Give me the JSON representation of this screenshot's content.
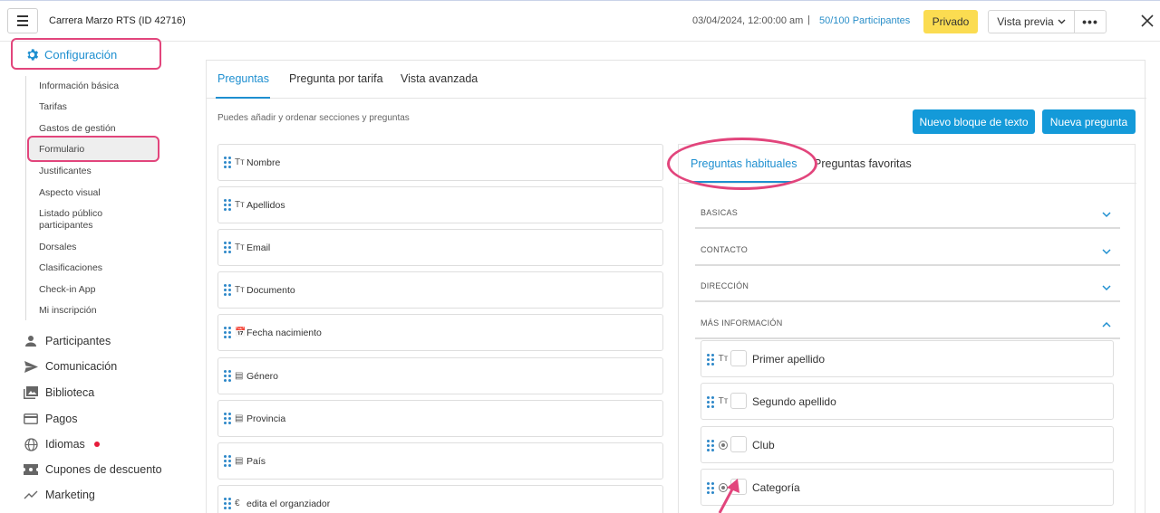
{
  "header": {
    "event_title": "Carrera Marzo RTS (ID 42716)",
    "date": "03/04/2024, 12:00:00 am",
    "separator": "|",
    "participants": "50/100 Participantes",
    "private_label": "Privado",
    "preview_label": "Vista previa",
    "more_label": "•••"
  },
  "sidebar": {
    "config_label": "Configuración",
    "sub_items": [
      "Información básica",
      "Tarifas",
      "Gastos de gestión",
      "Formulario",
      "Justificantes",
      "Aspecto visual",
      "Listado público participantes",
      "Dorsales",
      "Clasificaciones",
      "Check-in App",
      "Mi inscripción"
    ],
    "main_items": [
      {
        "label": "Participantes",
        "icon": "person-icon"
      },
      {
        "label": "Comunicación",
        "icon": "send-icon"
      },
      {
        "label": "Biblioteca",
        "icon": "library-icon"
      },
      {
        "label": "Pagos",
        "icon": "card-icon"
      },
      {
        "label": "Idiomas",
        "icon": "globe-icon"
      },
      {
        "label": "Cupones de descuento",
        "icon": "coupon-icon"
      },
      {
        "label": "Marketing",
        "icon": "trend-icon"
      }
    ]
  },
  "main": {
    "tabs": [
      "Preguntas",
      "Pregunta por tarifa",
      "Vista avanzada"
    ],
    "hint": "Puedes añadir y ordenar secciones y preguntas",
    "btn_text_block": "Nuevo bloque de texto",
    "btn_new_question": "Nueva pregunta",
    "questions": [
      {
        "icon": "Tт",
        "label": "Nombre"
      },
      {
        "icon": "Tт",
        "label": "Apellidos"
      },
      {
        "icon": "Tт",
        "label": "Email"
      },
      {
        "icon": "Tт",
        "label": "Documento"
      },
      {
        "icon": "📅",
        "label": "Fecha nacimiento"
      },
      {
        "icon": "▤",
        "label": "Género"
      },
      {
        "icon": "▤",
        "label": "Provincia"
      },
      {
        "icon": "▤",
        "label": "País"
      },
      {
        "icon": "€",
        "label": "edita el organziador"
      }
    ]
  },
  "right": {
    "tabs": [
      "Preguntas habituales",
      "Preguntas favoritas"
    ],
    "sections": [
      "BASICAS",
      "CONTACTO",
      "DIRECCIÓN",
      "MÁS INFORMACIÓN"
    ],
    "items": [
      {
        "icon": "Tт",
        "label": "Primer apellido"
      },
      {
        "icon": "Tт",
        "label": "Segundo apellido"
      },
      {
        "icon": "radio",
        "label": "Club"
      },
      {
        "icon": "radio",
        "label": "Categoría"
      }
    ]
  },
  "colors": {
    "accent": "#1e8fd0",
    "highlight": "#e2457c",
    "private": "#fbdc51",
    "button": "#149ad9"
  }
}
